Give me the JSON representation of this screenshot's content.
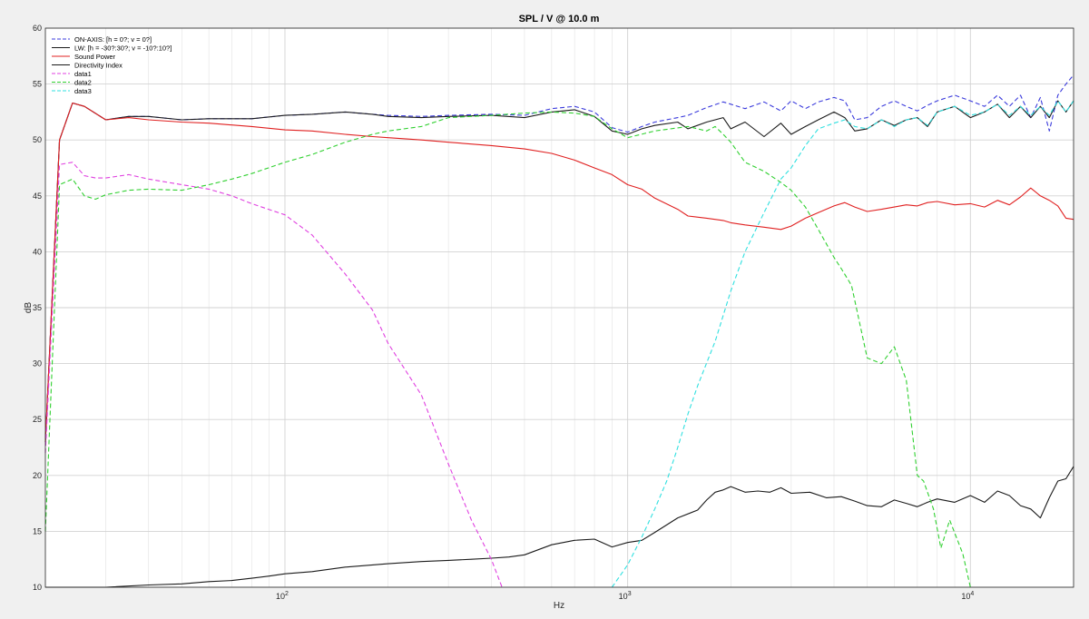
{
  "chart_data": {
    "type": "line",
    "title": "SPL / V @ 10.0 m",
    "xlabel": "Hz",
    "ylabel": "dB",
    "xscale": "log",
    "xlim": [
      20,
      20000
    ],
    "ylim": [
      10,
      60
    ],
    "yticks": [
      10,
      15,
      20,
      25,
      30,
      35,
      40,
      45,
      50,
      55,
      60
    ],
    "xticks": [
      {
        "value": 100,
        "base": "10",
        "exp": "2"
      },
      {
        "value": 1000,
        "base": "10",
        "exp": "3"
      },
      {
        "value": 10000,
        "base": "10",
        "exp": "4"
      }
    ],
    "grid": true,
    "legend_position": "top-left",
    "series": [
      {
        "name": "ON-AXIS: [h = 0?; v = 0?]",
        "color": "#3b3bdc",
        "style": "dashed",
        "x": [
          20,
          22,
          24,
          26,
          30,
          35,
          40,
          50,
          60,
          80,
          100,
          120,
          150,
          180,
          200,
          250,
          300,
          400,
          500,
          600,
          700,
          800,
          900,
          1000,
          1100,
          1200,
          1400,
          1500,
          1700,
          1900,
          2000,
          2200,
          2500,
          2800,
          3000,
          3300,
          3600,
          4000,
          4300,
          4600,
          5000,
          5500,
          6000,
          6500,
          7000,
          7500,
          8000,
          9000,
          10000,
          11000,
          12000,
          13000,
          14000,
          15000,
          16000,
          17000,
          18000,
          19000,
          20000
        ],
        "y": [
          23,
          50,
          53.3,
          53,
          51.8,
          52.1,
          52.1,
          51.8,
          51.9,
          51.9,
          52.2,
          52.3,
          52.5,
          52.3,
          52.2,
          52.1,
          52.2,
          52.3,
          52.2,
          52.8,
          53.0,
          52.5,
          51.1,
          50.7,
          51.2,
          51.6,
          52.0,
          52.2,
          52.9,
          53.4,
          53.2,
          52.8,
          53.4,
          52.6,
          53.5,
          52.8,
          53.4,
          53.8,
          53.5,
          51.8,
          52.0,
          53.0,
          53.5,
          53.0,
          52.6,
          53.1,
          53.5,
          54.0,
          53.5,
          53.0,
          54.0,
          53.0,
          54.0,
          52.0,
          53.8,
          50.8,
          54.0,
          55.0,
          55.8
        ]
      },
      {
        "name": "LW: [h = -30?:30?; v = -10?:10?]",
        "color": "#1a1a1a",
        "style": "solid",
        "x": [
          20,
          22,
          24,
          26,
          30,
          35,
          40,
          50,
          60,
          80,
          100,
          120,
          150,
          180,
          200,
          250,
          300,
          400,
          500,
          600,
          700,
          800,
          900,
          1000,
          1100,
          1200,
          1400,
          1500,
          1700,
          1900,
          2000,
          2200,
          2500,
          2800,
          3000,
          3300,
          3600,
          4000,
          4300,
          4600,
          5000,
          5500,
          6000,
          6500,
          7000,
          7500,
          8000,
          9000,
          10000,
          11000,
          12000,
          13000,
          14000,
          15000,
          16000,
          17000,
          18000,
          19000,
          20000
        ],
        "y": [
          23,
          50,
          53.3,
          53,
          51.8,
          52.1,
          52.1,
          51.8,
          51.9,
          51.9,
          52.2,
          52.3,
          52.5,
          52.3,
          52.1,
          52.0,
          52.1,
          52.2,
          52.0,
          52.5,
          52.7,
          52.1,
          50.8,
          50.5,
          51.0,
          51.3,
          51.6,
          51.0,
          51.6,
          52.0,
          51.0,
          51.6,
          50.3,
          51.5,
          50.5,
          51.2,
          51.8,
          52.5,
          52.0,
          50.8,
          51.0,
          51.8,
          51.3,
          51.8,
          52.0,
          51.2,
          52.5,
          53.0,
          52.0,
          52.5,
          53.2,
          52.0,
          53.0,
          52.0,
          53.0,
          52.0,
          53.5,
          52.5,
          53.5
        ]
      },
      {
        "name": "Sound Power",
        "color": "#e02020",
        "style": "solid",
        "x": [
          20,
          22,
          24,
          26,
          30,
          35,
          40,
          50,
          60,
          80,
          100,
          120,
          150,
          180,
          200,
          250,
          300,
          400,
          500,
          600,
          700,
          800,
          900,
          1000,
          1100,
          1200,
          1400,
          1500,
          1700,
          1900,
          2000,
          2200,
          2500,
          2800,
          3000,
          3300,
          3600,
          4000,
          4300,
          4600,
          5000,
          5500,
          6000,
          6500,
          7000,
          7500,
          8000,
          9000,
          10000,
          11000,
          12000,
          13000,
          14000,
          15000,
          16000,
          17000,
          18000,
          19000,
          20000
        ],
        "y": [
          23,
          50,
          53.3,
          53,
          51.8,
          52.0,
          51.8,
          51.6,
          51.5,
          51.2,
          50.9,
          50.8,
          50.5,
          50.3,
          50.2,
          50.0,
          49.8,
          49.5,
          49.2,
          48.8,
          48.2,
          47.5,
          46.9,
          46.0,
          45.6,
          44.8,
          43.8,
          43.2,
          43.0,
          42.8,
          42.6,
          42.4,
          42.2,
          42.0,
          42.3,
          43.0,
          43.5,
          44.1,
          44.4,
          44.0,
          43.6,
          43.8,
          44.0,
          44.2,
          44.1,
          44.4,
          44.5,
          44.2,
          44.3,
          44.0,
          44.6,
          44.2,
          44.9,
          45.7,
          45.0,
          44.6,
          44.1,
          43.0,
          42.9
        ]
      },
      {
        "name": "Directivity Index",
        "color": "#1a1a1a",
        "style": "solid",
        "x": [
          20,
          25,
          30,
          40,
          50,
          60,
          70,
          80,
          90,
          100,
          120,
          150,
          200,
          250,
          300,
          350,
          400,
          450,
          500,
          600,
          700,
          800,
          900,
          1000,
          1100,
          1200,
          1400,
          1600,
          1700,
          1800,
          1900,
          2000,
          2200,
          2400,
          2600,
          2800,
          3000,
          3400,
          3800,
          4200,
          4600,
          5000,
          5500,
          6000,
          6500,
          7000,
          7500,
          8000,
          9000,
          10000,
          11000,
          12000,
          13000,
          14000,
          15000,
          16000,
          17000,
          18000,
          19000,
          20000
        ],
        "y": [
          10,
          10,
          10,
          10.2,
          10.3,
          10.5,
          10.6,
          10.8,
          11.0,
          11.2,
          11.4,
          11.8,
          12.1,
          12.3,
          12.4,
          12.5,
          12.6,
          12.7,
          12.9,
          13.8,
          14.2,
          14.3,
          13.6,
          14.0,
          14.2,
          14.9,
          16.2,
          16.9,
          17.8,
          18.5,
          18.7,
          19.0,
          18.5,
          18.6,
          18.5,
          18.9,
          18.4,
          18.5,
          18.0,
          18.1,
          17.7,
          17.3,
          17.2,
          17.8,
          17.5,
          17.2,
          17.6,
          17.9,
          17.6,
          18.2,
          17.6,
          18.6,
          18.2,
          17.3,
          17.0,
          16.2,
          18.0,
          19.5,
          19.7,
          20.8
        ]
      },
      {
        "name": "data1",
        "color": "#e040e0",
        "style": "dashed",
        "x": [
          20,
          22,
          24,
          26,
          28,
          30,
          35,
          40,
          50,
          60,
          70,
          80,
          100,
          120,
          150,
          180,
          200,
          250,
          300,
          350,
          400,
          430
        ],
        "y": [
          22,
          47.8,
          48.0,
          46.8,
          46.6,
          46.6,
          46.9,
          46.5,
          46.0,
          45.6,
          45.0,
          44.3,
          43.3,
          41.5,
          38.0,
          34.8,
          31.8,
          27.2,
          21.0,
          16.0,
          12.5,
          10.0
        ]
      },
      {
        "name": "data2",
        "color": "#30d030",
        "style": "dashed",
        "x": [
          20,
          22,
          24,
          26,
          28,
          30,
          35,
          40,
          50,
          60,
          70,
          80,
          100,
          120,
          150,
          180,
          200,
          250,
          300,
          400,
          500,
          600,
          700,
          800,
          900,
          1000,
          1200,
          1500,
          1700,
          1800,
          1900,
          2000,
          2200,
          2500,
          2800,
          3000,
          3300,
          3600,
          4000,
          4200,
          4500,
          5000,
          5500,
          6000,
          6500,
          7000,
          7300,
          7800,
          8200,
          8700,
          9500,
          10000
        ],
        "y": [
          15,
          46.0,
          46.5,
          45.0,
          44.7,
          45.1,
          45.5,
          45.6,
          45.5,
          46.0,
          46.5,
          47.0,
          48.0,
          48.7,
          49.8,
          50.5,
          50.8,
          51.2,
          52.0,
          52.2,
          52.4,
          52.5,
          52.4,
          52.1,
          51.0,
          50.2,
          50.8,
          51.2,
          50.8,
          51.2,
          50.5,
          49.8,
          48.0,
          47.2,
          46.2,
          45.5,
          44.0,
          42.0,
          39.5,
          38.5,
          37.0,
          30.5,
          30.0,
          31.5,
          28.5,
          20.0,
          19.5,
          17.0,
          13.5,
          16.0,
          13.0,
          10.0
        ]
      },
      {
        "name": "data3",
        "color": "#30e0e0",
        "style": "dashed",
        "x": [
          900,
          1000,
          1100,
          1200,
          1300,
          1400,
          1500,
          1600,
          1800,
          2000,
          2200,
          2500,
          2800,
          3000,
          3300,
          3600,
          4000,
          4300,
          4600,
          5000,
          5500,
          6000,
          6500,
          7000,
          7500,
          8000,
          9000,
          10000,
          11000,
          12000,
          13000,
          14000,
          15000,
          16000,
          17000,
          18000,
          19000,
          20000
        ],
        "y": [
          10,
          12,
          14.5,
          17,
          19.5,
          22.5,
          25.5,
          28,
          32,
          36.5,
          40.0,
          43.5,
          46.5,
          47.5,
          49.5,
          51.0,
          51.5,
          51.8,
          51.2,
          51.0,
          51.8,
          51.2,
          51.8,
          52.0,
          51.3,
          52.5,
          53.0,
          52.2,
          52.5,
          53.2,
          52.2,
          53.0,
          52.2,
          53.0,
          52.2,
          53.5,
          52.5,
          53.5
        ]
      }
    ]
  }
}
